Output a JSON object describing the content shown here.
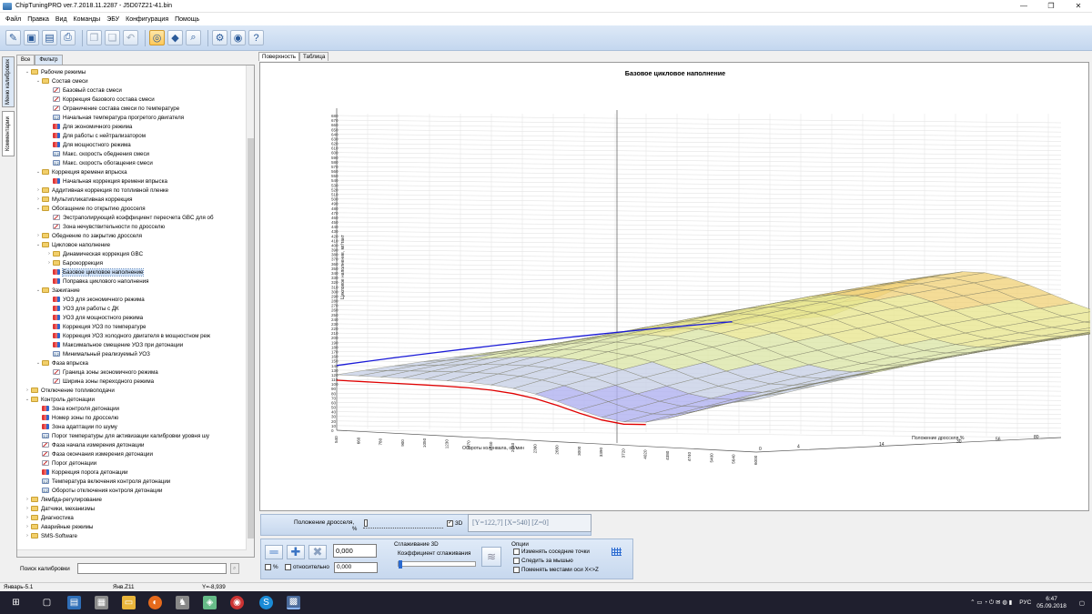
{
  "window": {
    "title": "ChipTuningPRO ver.7.2018.11.2287 - J5D07Z21-41.bin",
    "min": "—",
    "max": "❐",
    "close": "✕"
  },
  "menu": [
    "Файл",
    "Правка",
    "Вид",
    "Команды",
    "ЭБУ",
    "Конфигурация",
    "Помощь"
  ],
  "side_tabs": [
    "Меню калибровок",
    "Комментарии"
  ],
  "left_tabs": [
    "Все",
    "Фильтр"
  ],
  "tree": [
    {
      "label": "Рабочие режимы",
      "level": 0,
      "type": "folder",
      "open": true
    },
    {
      "label": "Состав смеси",
      "level": 1,
      "type": "folder",
      "open": true
    },
    {
      "label": "Базовый состав смеси",
      "level": 2,
      "type": "curve"
    },
    {
      "label": "Коррекция базового состава смеси",
      "level": 2,
      "type": "curve"
    },
    {
      "label": "Ограничение состава смеси по температуре",
      "level": 2,
      "type": "curve"
    },
    {
      "label": "Начальная температура прогретого двигателя",
      "level": 2,
      "type": "val"
    },
    {
      "label": "Для экономичного режима",
      "level": 2,
      "type": "map"
    },
    {
      "label": "Для работы с нейтрализатором",
      "level": 2,
      "type": "map"
    },
    {
      "label": "Для мощностного режима",
      "level": 2,
      "type": "map"
    },
    {
      "label": "Макс. скорость обеднения смеси",
      "level": 2,
      "type": "val"
    },
    {
      "label": "Макс. скорость обогащения смеси",
      "level": 2,
      "type": "val"
    },
    {
      "label": "Коррекция времени впрыска",
      "level": 1,
      "type": "folder",
      "open": true
    },
    {
      "label": "Начальная коррекция времени впрыска",
      "level": 2,
      "type": "map"
    },
    {
      "label": "Аддитивная коррекция по топливной пленке",
      "level": 1,
      "type": "folder",
      "open": false
    },
    {
      "label": "Мультипликативная коррекция",
      "level": 1,
      "type": "folder",
      "open": false
    },
    {
      "label": "Обогащение по открытию дросселя",
      "level": 1,
      "type": "folder",
      "open": true
    },
    {
      "label": "Экстраполирующий коэффициент пересчета GBC для об",
      "level": 2,
      "type": "curve"
    },
    {
      "label": "Зона нечувствительности по дросселю",
      "level": 2,
      "type": "curve"
    },
    {
      "label": "Обеднение по закрытию дросселя",
      "level": 1,
      "type": "folder",
      "open": false
    },
    {
      "label": "Цикловое наполнение",
      "level": 1,
      "type": "folder",
      "open": true
    },
    {
      "label": "Динамическая коррекция GBC",
      "level": 2,
      "type": "folder",
      "open": false
    },
    {
      "label": "Барокоррекция",
      "level": 2,
      "type": "folder",
      "open": false
    },
    {
      "label": "Базовое цикловое наполнение",
      "level": 2,
      "type": "map",
      "selected": true
    },
    {
      "label": "Поправка циклового наполнения",
      "level": 2,
      "type": "map"
    },
    {
      "label": "Зажигание",
      "level": 1,
      "type": "folder",
      "open": true
    },
    {
      "label": "УОЗ для экономичного режима",
      "level": 2,
      "type": "map"
    },
    {
      "label": "УОЗ для работы с ДК",
      "level": 2,
      "type": "map"
    },
    {
      "label": "УОЗ для мощностного режима",
      "level": 2,
      "type": "map"
    },
    {
      "label": "Коррекция УОЗ по температуре",
      "level": 2,
      "type": "map"
    },
    {
      "label": "Коррекция УОЗ холодного двигателя в мощностном реж",
      "level": 2,
      "type": "map"
    },
    {
      "label": "Максимальное смещение УОЗ при детонации",
      "level": 2,
      "type": "map"
    },
    {
      "label": "Минимальный реализуемый УОЗ",
      "level": 2,
      "type": "val"
    },
    {
      "label": "Фаза впрыска",
      "level": 1,
      "type": "folder",
      "open": true
    },
    {
      "label": "Граница зоны экономичного режима",
      "level": 2,
      "type": "curve"
    },
    {
      "label": "Ширина зоны переходного режима",
      "level": 2,
      "type": "curve"
    },
    {
      "label": "Отключение топливоподачи",
      "level": 0,
      "type": "folder",
      "open": false
    },
    {
      "label": "Контроль детонации",
      "level": 0,
      "type": "folder",
      "open": true
    },
    {
      "label": "Зона контроля детонации",
      "level": 1,
      "type": "map"
    },
    {
      "label": "Номер зоны по дросселю",
      "level": 1,
      "type": "map"
    },
    {
      "label": "Зона адаптации по шуму",
      "level": 1,
      "type": "map"
    },
    {
      "label": "Порог температуры для активизации калибровки уровня шу",
      "level": 1,
      "type": "val"
    },
    {
      "label": "Фаза начала измерения детонации",
      "level": 1,
      "type": "curve"
    },
    {
      "label": "Фаза окончания измерения детонации",
      "level": 1,
      "type": "curve"
    },
    {
      "label": "Порог детонации",
      "level": 1,
      "type": "curve"
    },
    {
      "label": "Коррекция порога детонации",
      "level": 1,
      "type": "map"
    },
    {
      "label": "Температура включения контроля детонации",
      "level": 1,
      "type": "val"
    },
    {
      "label": "Обороты отключения контроля детонации",
      "level": 1,
      "type": "val"
    },
    {
      "label": "Лямбда-регулирование",
      "level": 0,
      "type": "folder",
      "open": false
    },
    {
      "label": "Датчики, механизмы",
      "level": 0,
      "type": "folder",
      "open": false
    },
    {
      "label": "Диагностика",
      "level": 0,
      "type": "folder",
      "open": false
    },
    {
      "label": "Аварийные режимы",
      "level": 0,
      "type": "folder",
      "open": false
    },
    {
      "label": "SMS-Software",
      "level": 0,
      "type": "folder",
      "open": false
    }
  ],
  "search": {
    "label": "Поиск калибровки",
    "value": ""
  },
  "main_tabs": [
    "Поверхность",
    "Таблица"
  ],
  "chart_data": {
    "type": "surface3d",
    "title": "Базовое цикловое наполнение",
    "xlabel": "Обороты коленвала, об/мин",
    "ylabel": "Положение дросселя,%",
    "zlabel": "Цикловое наполнение, мг/такт",
    "z_ticks": [
      0,
      10,
      20,
      30,
      40,
      50,
      60,
      70,
      80,
      90,
      100,
      110,
      120,
      130,
      140,
      150,
      160,
      170,
      180,
      190,
      200,
      210,
      220,
      230,
      240,
      250,
      260,
      270,
      280,
      290,
      300,
      310,
      320,
      330,
      340,
      350,
      360,
      370,
      380,
      390,
      400,
      410,
      420,
      430,
      440,
      450,
      460,
      470,
      480,
      490,
      500,
      510,
      520,
      530,
      540,
      550,
      560,
      570,
      580,
      590,
      600,
      610,
      620,
      630,
      640,
      650,
      660,
      670,
      680
    ],
    "rpm_ticks": [
      540,
      660,
      780,
      900,
      1050,
      1230,
      1470,
      1740,
      2040,
      2360,
      2680,
      3000,
      3390,
      3720,
      4020,
      4380,
      4740,
      5400,
      5640,
      6000
    ],
    "rpm_tick_labels": [
      540,
      660,
      780,
      900,
      1050,
      1230,
      1470,
      1740,
      2040,
      2360,
      2680,
      3000,
      3390,
      3720,
      4020,
      4380,
      4740,
      5400,
      5640,
      6000
    ],
    "throttle_ticks": [
      0,
      4,
      14,
      30,
      56,
      80
    ],
    "throttle_tick_labels": [
      0,
      4,
      14,
      30,
      56,
      80
    ],
    "grid": true
  },
  "controls": {
    "throttle_label": "Положение дросселя,",
    "percent": "%",
    "checkbox_3d": "3D",
    "coords": "[Y=122,7] [X=540] [Z=0]",
    "value1": "0,000",
    "value2": "0,000",
    "pct_label": "%",
    "relative_label": "относительно",
    "smoothing_title": "Сглаживание 3D",
    "smoothing_coef": "Коэффициент сглаживания",
    "options_title": "Опции",
    "opt1": "Изменять соседние точки",
    "opt2": "Следить за мышью",
    "opt3": "Поменять местами оси X<>Z"
  },
  "status": {
    "s1": "Январь-5.1",
    "s2": "Янв.Z11",
    "s3": "Y=-8,939"
  },
  "taskbar": {
    "lang": "РУС",
    "time": "6:47",
    "date": "05.09.2018"
  },
  "colors": {
    "accent": "#3a74c4",
    "surface_high": "#f2a54f",
    "surface_mid": "#e6e48a",
    "surface_low": "#a9a9f0",
    "line_red": "#e00000",
    "line_blue": "#1a1ad8"
  }
}
